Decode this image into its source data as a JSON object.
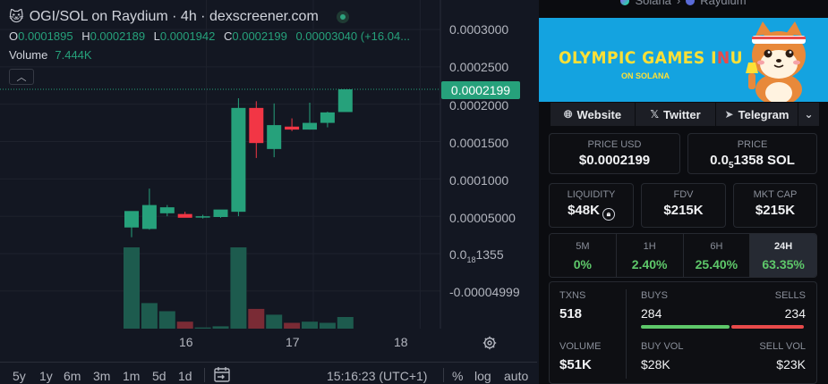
{
  "header": {
    "emoji": "🐱",
    "title": "OGI/SOL on Raydium · 4h · dexscreener.com"
  },
  "ohlc": {
    "o_label": "O",
    "o": "0.0001895",
    "h_label": "H",
    "h": "0.0002189",
    "l_label": "L",
    "l": "0.0001942",
    "c_label": "C",
    "c": "0.0002199",
    "change": "0.00003040 (+16.04..."
  },
  "volume": {
    "label": "Volume",
    "value": "7.444K"
  },
  "price_tag": "0.0002199",
  "y_axis": {
    "t0": "0.0003000",
    "t1": "0.0002500",
    "t2": "0.0002000",
    "t3": "0.0001500",
    "t4": "0.0001000",
    "t5": "0.00005000",
    "t6_pre": "0.0",
    "t6_sub": "18",
    "t6_post": "1355",
    "t7": "-0.00004999"
  },
  "x_axis": {
    "d16": "16",
    "d17": "17",
    "d18": "18"
  },
  "chart_data": {
    "type": "candlestick",
    "ylim": [
      -7e-05,
      0.00032
    ],
    "y_ticks": [
      0.0003,
      0.00025,
      0.0002,
      0.00015,
      0.0001,
      5e-05,
      0.0,
      -5e-05
    ],
    "x_ticks": [
      {
        "label": "16",
        "index": 4.2
      },
      {
        "label": "17",
        "index": 10.2
      },
      {
        "label": "18",
        "index": 16.2
      }
    ],
    "current_price": 0.0002199,
    "candles": [
      {
        "o": 3.5e-05,
        "h": 4.5e-05,
        "l": 2.2e-05,
        "c": 5.7e-05,
        "v": 7.0
      },
      {
        "o": 3.3e-05,
        "h": 8.7e-05,
        "l": 3.2e-05,
        "c": 6.5e-05,
        "v": 2.2
      },
      {
        "o": 5.4e-05,
        "h": 6.5e-05,
        "l": 5e-05,
        "c": 6.2e-05,
        "v": 1.5
      },
      {
        "o": 5.3e-05,
        "h": 5.6e-05,
        "l": 5e-05,
        "c": 4.8e-05,
        "v": 0.6
      },
      {
        "o": 4.9e-05,
        "h": 5.2e-05,
        "l": 4.7e-05,
        "c": 5e-05,
        "v": 0.1
      },
      {
        "o": 4.9e-05,
        "h": 5.8e-05,
        "l": 4.8e-05,
        "c": 5.9e-05,
        "v": 0.2
      },
      {
        "o": 5.6e-05,
        "h": 0.000208,
        "l": 5e-05,
        "c": 0.000195,
        "v": 7.0
      },
      {
        "o": 0.000195,
        "h": 0.000204,
        "l": 0.000128,
        "c": 0.000148,
        "v": 1.7
      },
      {
        "o": 0.00014,
        "h": 0.000201,
        "l": 0.000129,
        "c": 0.000172,
        "v": 1.2
      },
      {
        "o": 0.00017,
        "h": 0.000181,
        "l": 0.000164,
        "c": 0.000166,
        "v": 0.5
      },
      {
        "o": 0.000166,
        "h": 0.000202,
        "l": 0.000166,
        "c": 0.000175,
        "v": 0.6
      },
      {
        "o": 0.000175,
        "h": 0.00019,
        "l": 0.000169,
        "c": 0.000189,
        "v": 0.5
      },
      {
        "o": 0.0001895,
        "h": 0.0002189,
        "l": 0.0001942,
        "c": 0.0002199,
        "v": 1.0
      }
    ],
    "colors": {
      "up": "#26a17b",
      "down": "#f23645",
      "up_vol": "#1d5b4e",
      "down_vol": "#7a2b35"
    }
  },
  "bottom_bar": {
    "ranges": [
      "5y",
      "1y",
      "6m",
      "3m",
      "1m",
      "5d",
      "1d"
    ],
    "time": "15:16:23 (UTC+1)",
    "pct": "%",
    "log": "log",
    "auto": "auto"
  },
  "breadcrumb": {
    "chain": "Solana",
    "dex": "Raydium"
  },
  "banner": {
    "title_a": "OLYMPIC GAMES I",
    "title_b": "N",
    "title_c": "U",
    "subtitle": "ON SOLANA"
  },
  "links": {
    "website": "Website",
    "twitter": "Twitter",
    "telegram": "Telegram"
  },
  "price_usd": {
    "label": "PRICE USD",
    "value": "$0.0002199"
  },
  "price_native": {
    "label": "PRICE",
    "pre": "0.0",
    "sub": "5",
    "post": "1358 SOL"
  },
  "liquidity": {
    "label": "LIQUIDITY",
    "value": "$48K"
  },
  "fdv": {
    "label": "FDV",
    "value": "$215K"
  },
  "mkt_cap": {
    "label": "MKT CAP",
    "value": "$215K"
  },
  "timeframes": [
    {
      "label": "5M",
      "value": "0%"
    },
    {
      "label": "1H",
      "value": "2.40%"
    },
    {
      "label": "6H",
      "value": "25.40%"
    },
    {
      "label": "24H",
      "value": "63.35%"
    }
  ],
  "txns": {
    "label": "TXNS",
    "value": "518"
  },
  "buys": {
    "label": "BUYS",
    "value": "284",
    "share": 0.548
  },
  "sells": {
    "label": "SELLS",
    "value": "234",
    "share": 0.452
  },
  "volume_stats": {
    "label": "VOLUME",
    "value": "$51K"
  },
  "buy_vol": {
    "label": "BUY VOL",
    "value": "$28K"
  },
  "sell_vol": {
    "label": "SELL VOL",
    "value": "$23K"
  },
  "colors": {
    "buy": "#5ec86a",
    "sell": "#e84a4a",
    "accent": "#26a17b"
  }
}
